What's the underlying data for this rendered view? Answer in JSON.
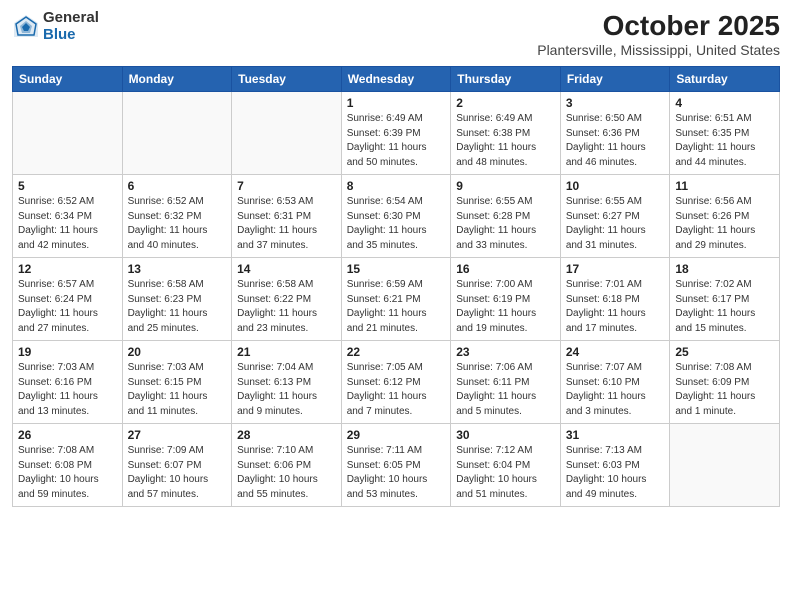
{
  "logo": {
    "general": "General",
    "blue": "Blue"
  },
  "title": "October 2025",
  "subtitle": "Plantersville, Mississippi, United States",
  "weekdays": [
    "Sunday",
    "Monday",
    "Tuesday",
    "Wednesday",
    "Thursday",
    "Friday",
    "Saturday"
  ],
  "weeks": [
    [
      {
        "day": "",
        "info": ""
      },
      {
        "day": "",
        "info": ""
      },
      {
        "day": "",
        "info": ""
      },
      {
        "day": "1",
        "info": "Sunrise: 6:49 AM\nSunset: 6:39 PM\nDaylight: 11 hours\nand 50 minutes."
      },
      {
        "day": "2",
        "info": "Sunrise: 6:49 AM\nSunset: 6:38 PM\nDaylight: 11 hours\nand 48 minutes."
      },
      {
        "day": "3",
        "info": "Sunrise: 6:50 AM\nSunset: 6:36 PM\nDaylight: 11 hours\nand 46 minutes."
      },
      {
        "day": "4",
        "info": "Sunrise: 6:51 AM\nSunset: 6:35 PM\nDaylight: 11 hours\nand 44 minutes."
      }
    ],
    [
      {
        "day": "5",
        "info": "Sunrise: 6:52 AM\nSunset: 6:34 PM\nDaylight: 11 hours\nand 42 minutes."
      },
      {
        "day": "6",
        "info": "Sunrise: 6:52 AM\nSunset: 6:32 PM\nDaylight: 11 hours\nand 40 minutes."
      },
      {
        "day": "7",
        "info": "Sunrise: 6:53 AM\nSunset: 6:31 PM\nDaylight: 11 hours\nand 37 minutes."
      },
      {
        "day": "8",
        "info": "Sunrise: 6:54 AM\nSunset: 6:30 PM\nDaylight: 11 hours\nand 35 minutes."
      },
      {
        "day": "9",
        "info": "Sunrise: 6:55 AM\nSunset: 6:28 PM\nDaylight: 11 hours\nand 33 minutes."
      },
      {
        "day": "10",
        "info": "Sunrise: 6:55 AM\nSunset: 6:27 PM\nDaylight: 11 hours\nand 31 minutes."
      },
      {
        "day": "11",
        "info": "Sunrise: 6:56 AM\nSunset: 6:26 PM\nDaylight: 11 hours\nand 29 minutes."
      }
    ],
    [
      {
        "day": "12",
        "info": "Sunrise: 6:57 AM\nSunset: 6:24 PM\nDaylight: 11 hours\nand 27 minutes."
      },
      {
        "day": "13",
        "info": "Sunrise: 6:58 AM\nSunset: 6:23 PM\nDaylight: 11 hours\nand 25 minutes."
      },
      {
        "day": "14",
        "info": "Sunrise: 6:58 AM\nSunset: 6:22 PM\nDaylight: 11 hours\nand 23 minutes."
      },
      {
        "day": "15",
        "info": "Sunrise: 6:59 AM\nSunset: 6:21 PM\nDaylight: 11 hours\nand 21 minutes."
      },
      {
        "day": "16",
        "info": "Sunrise: 7:00 AM\nSunset: 6:19 PM\nDaylight: 11 hours\nand 19 minutes."
      },
      {
        "day": "17",
        "info": "Sunrise: 7:01 AM\nSunset: 6:18 PM\nDaylight: 11 hours\nand 17 minutes."
      },
      {
        "day": "18",
        "info": "Sunrise: 7:02 AM\nSunset: 6:17 PM\nDaylight: 11 hours\nand 15 minutes."
      }
    ],
    [
      {
        "day": "19",
        "info": "Sunrise: 7:03 AM\nSunset: 6:16 PM\nDaylight: 11 hours\nand 13 minutes."
      },
      {
        "day": "20",
        "info": "Sunrise: 7:03 AM\nSunset: 6:15 PM\nDaylight: 11 hours\nand 11 minutes."
      },
      {
        "day": "21",
        "info": "Sunrise: 7:04 AM\nSunset: 6:13 PM\nDaylight: 11 hours\nand 9 minutes."
      },
      {
        "day": "22",
        "info": "Sunrise: 7:05 AM\nSunset: 6:12 PM\nDaylight: 11 hours\nand 7 minutes."
      },
      {
        "day": "23",
        "info": "Sunrise: 7:06 AM\nSunset: 6:11 PM\nDaylight: 11 hours\nand 5 minutes."
      },
      {
        "day": "24",
        "info": "Sunrise: 7:07 AM\nSunset: 6:10 PM\nDaylight: 11 hours\nand 3 minutes."
      },
      {
        "day": "25",
        "info": "Sunrise: 7:08 AM\nSunset: 6:09 PM\nDaylight: 11 hours\nand 1 minute."
      }
    ],
    [
      {
        "day": "26",
        "info": "Sunrise: 7:08 AM\nSunset: 6:08 PM\nDaylight: 10 hours\nand 59 minutes."
      },
      {
        "day": "27",
        "info": "Sunrise: 7:09 AM\nSunset: 6:07 PM\nDaylight: 10 hours\nand 57 minutes."
      },
      {
        "day": "28",
        "info": "Sunrise: 7:10 AM\nSunset: 6:06 PM\nDaylight: 10 hours\nand 55 minutes."
      },
      {
        "day": "29",
        "info": "Sunrise: 7:11 AM\nSunset: 6:05 PM\nDaylight: 10 hours\nand 53 minutes."
      },
      {
        "day": "30",
        "info": "Sunrise: 7:12 AM\nSunset: 6:04 PM\nDaylight: 10 hours\nand 51 minutes."
      },
      {
        "day": "31",
        "info": "Sunrise: 7:13 AM\nSunset: 6:03 PM\nDaylight: 10 hours\nand 49 minutes."
      },
      {
        "day": "",
        "info": ""
      }
    ]
  ]
}
